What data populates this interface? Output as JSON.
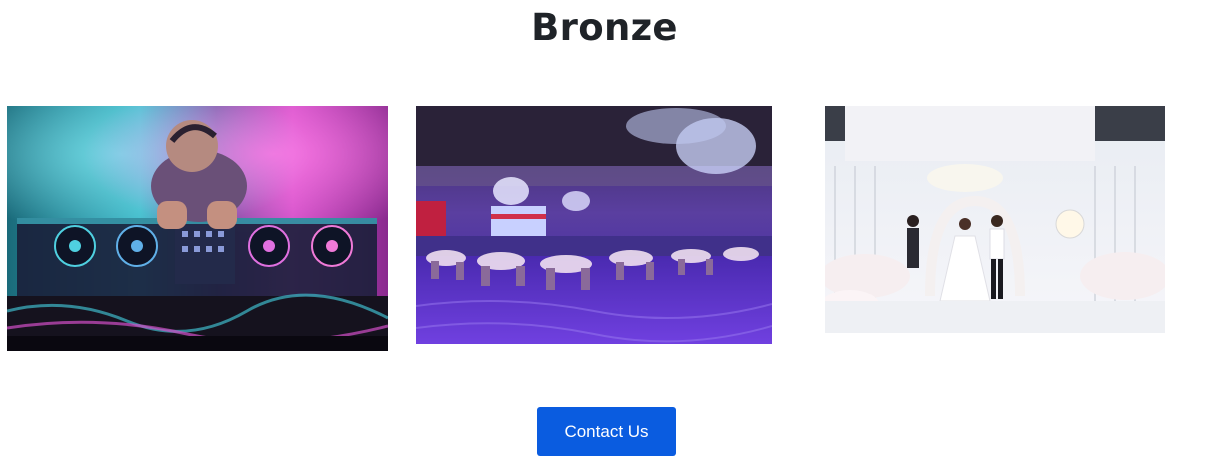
{
  "package": {
    "title": "Bronze"
  },
  "gallery": {
    "photos": [
      {
        "subject": "dj-mixing-at-turntables"
      },
      {
        "subject": "banquet-hall-with-chandeliers"
      },
      {
        "subject": "white-floral-wedding-ceremony"
      }
    ]
  },
  "cta": {
    "label": "Contact Us",
    "color": "#0a5ce0"
  }
}
